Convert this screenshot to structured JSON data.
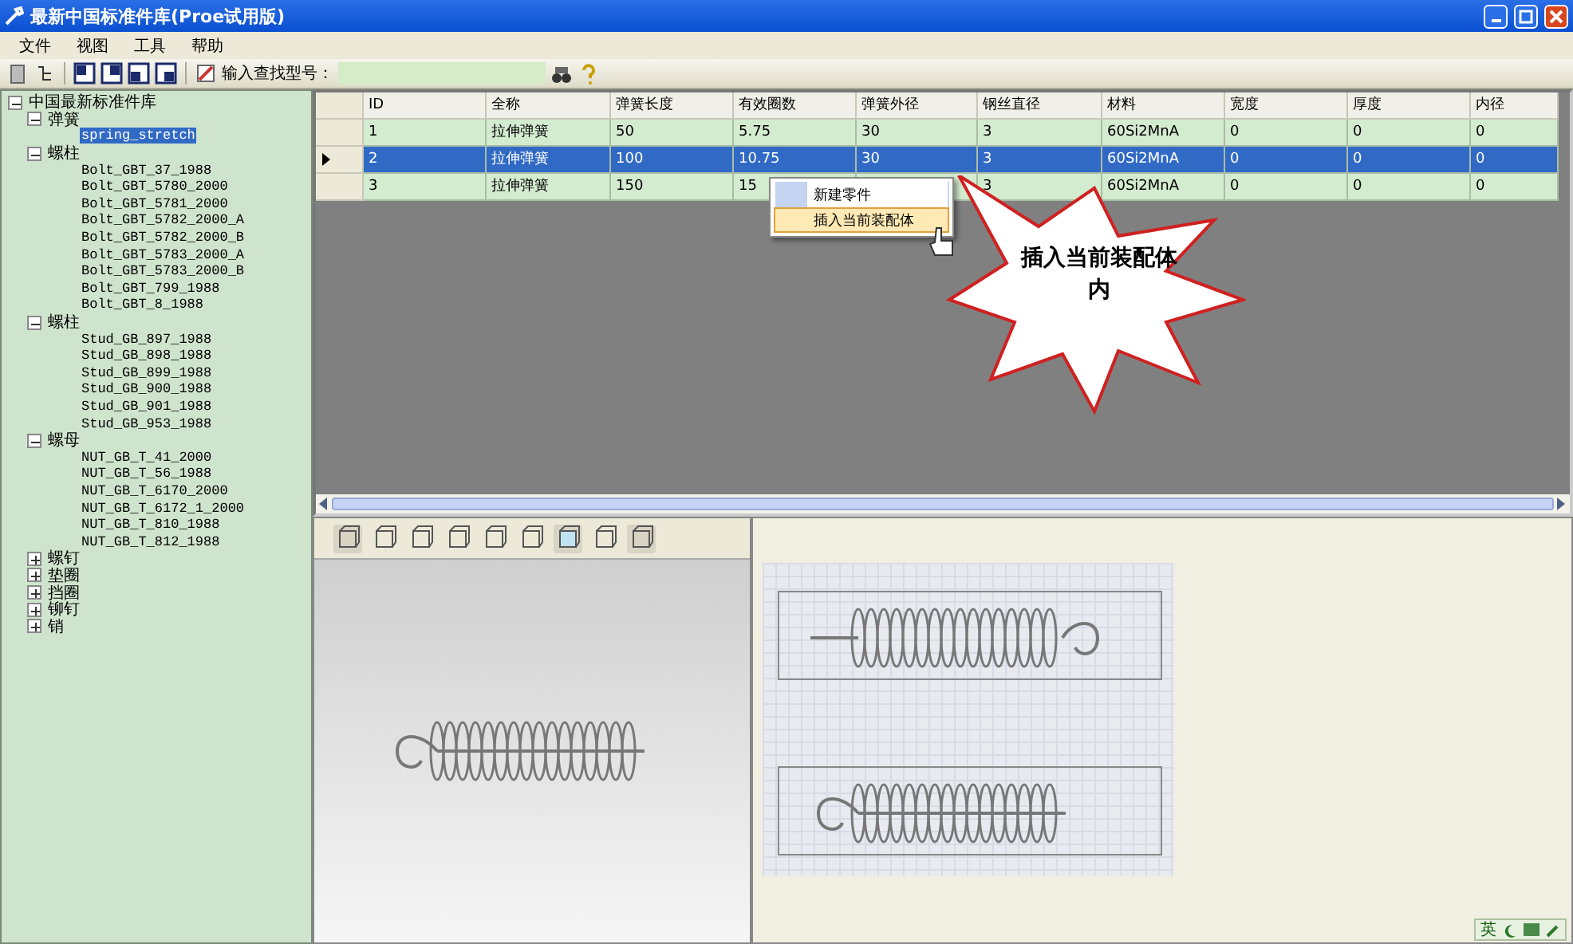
{
  "window": {
    "title": "最新中国标准件库(Proe试用版)"
  },
  "menu": [
    "文件",
    "视图",
    "工具",
    "帮助"
  ],
  "toolbar": {
    "search_label": "输入查找型号："
  },
  "tree": {
    "label": "中国最新标准件库",
    "expanded": true,
    "children": [
      {
        "label": "弹簧",
        "expanded": true,
        "children": [
          {
            "label": "spring_stretch",
            "selected": true
          }
        ]
      },
      {
        "label": "螺柱",
        "expanded": true,
        "children": [
          {
            "label": "Bolt_GBT_37_1988",
            "selected": false
          },
          {
            "label": "Bolt_GBT_5780_2000",
            "selected": false
          },
          {
            "label": "Bolt_GBT_5781_2000",
            "selected": false
          },
          {
            "label": "Bolt_GBT_5782_2000_A",
            "selected": false
          },
          {
            "label": "Bolt_GBT_5782_2000_B",
            "selected": false
          },
          {
            "label": "Bolt_GBT_5783_2000_A",
            "selected": false
          },
          {
            "label": "Bolt_GBT_5783_2000_B",
            "selected": false
          },
          {
            "label": "Bolt_GBT_799_1988",
            "selected": false
          },
          {
            "label": "Bolt_GBT_8_1988",
            "selected": false
          }
        ]
      },
      {
        "label": "螺柱",
        "expanded": true,
        "children": [
          {
            "label": "Stud_GB_897_1988",
            "selected": false
          },
          {
            "label": "Stud_GB_898_1988",
            "selected": false
          },
          {
            "label": "Stud_GB_899_1988",
            "selected": false
          },
          {
            "label": "Stud_GB_900_1988",
            "selected": false
          },
          {
            "label": "Stud_GB_901_1988",
            "selected": false
          },
          {
            "label": "Stud_GB_953_1988",
            "selected": false
          }
        ]
      },
      {
        "label": "螺母",
        "expanded": true,
        "children": [
          {
            "label": "NUT_GB_T_41_2000",
            "selected": false
          },
          {
            "label": "NUT_GB_T_56_1988",
            "selected": false
          },
          {
            "label": "NUT_GB_T_6170_2000",
            "selected": false
          },
          {
            "label": "NUT_GB_T_6172_1_2000",
            "selected": false
          },
          {
            "label": "NUT_GB_T_810_1988",
            "selected": false
          },
          {
            "label": "NUT_GB_T_812_1988",
            "selected": false
          }
        ]
      },
      {
        "label": "螺钉",
        "expanded": false
      },
      {
        "label": "垫圈",
        "expanded": false
      },
      {
        "label": "挡圈",
        "expanded": false
      },
      {
        "label": "铆钉",
        "expanded": false
      },
      {
        "label": "销",
        "expanded": false
      }
    ]
  },
  "table": {
    "columns": [
      "ID",
      "全称",
      "弹簧长度",
      "有效圈数",
      "弹簧外径",
      "钢丝直径",
      "材料",
      "宽度",
      "厚度",
      "内径"
    ],
    "rows": [
      {
        "selected": false,
        "cells": [
          "1",
          "拉伸弹簧",
          "50",
          "5.75",
          "30",
          "3",
          "60Si2MnA",
          "0",
          "0",
          "0"
        ]
      },
      {
        "selected": true,
        "cells": [
          "2",
          "拉伸弹簧",
          "100",
          "10.75",
          "30",
          "3",
          "60Si2MnA",
          "0",
          "0",
          "0"
        ]
      },
      {
        "selected": false,
        "cells": [
          "3",
          "拉伸弹簧",
          "150",
          "15",
          null,
          "3",
          "60Si2MnA",
          "0",
          "0",
          "0"
        ]
      }
    ]
  },
  "context_menu": [
    {
      "label": "新建零件",
      "selected": false
    },
    {
      "label": "插入当前装配体",
      "selected": true
    }
  ],
  "callout": {
    "text": "插入当前装配体内"
  },
  "language_bar": {
    "label": "英"
  }
}
